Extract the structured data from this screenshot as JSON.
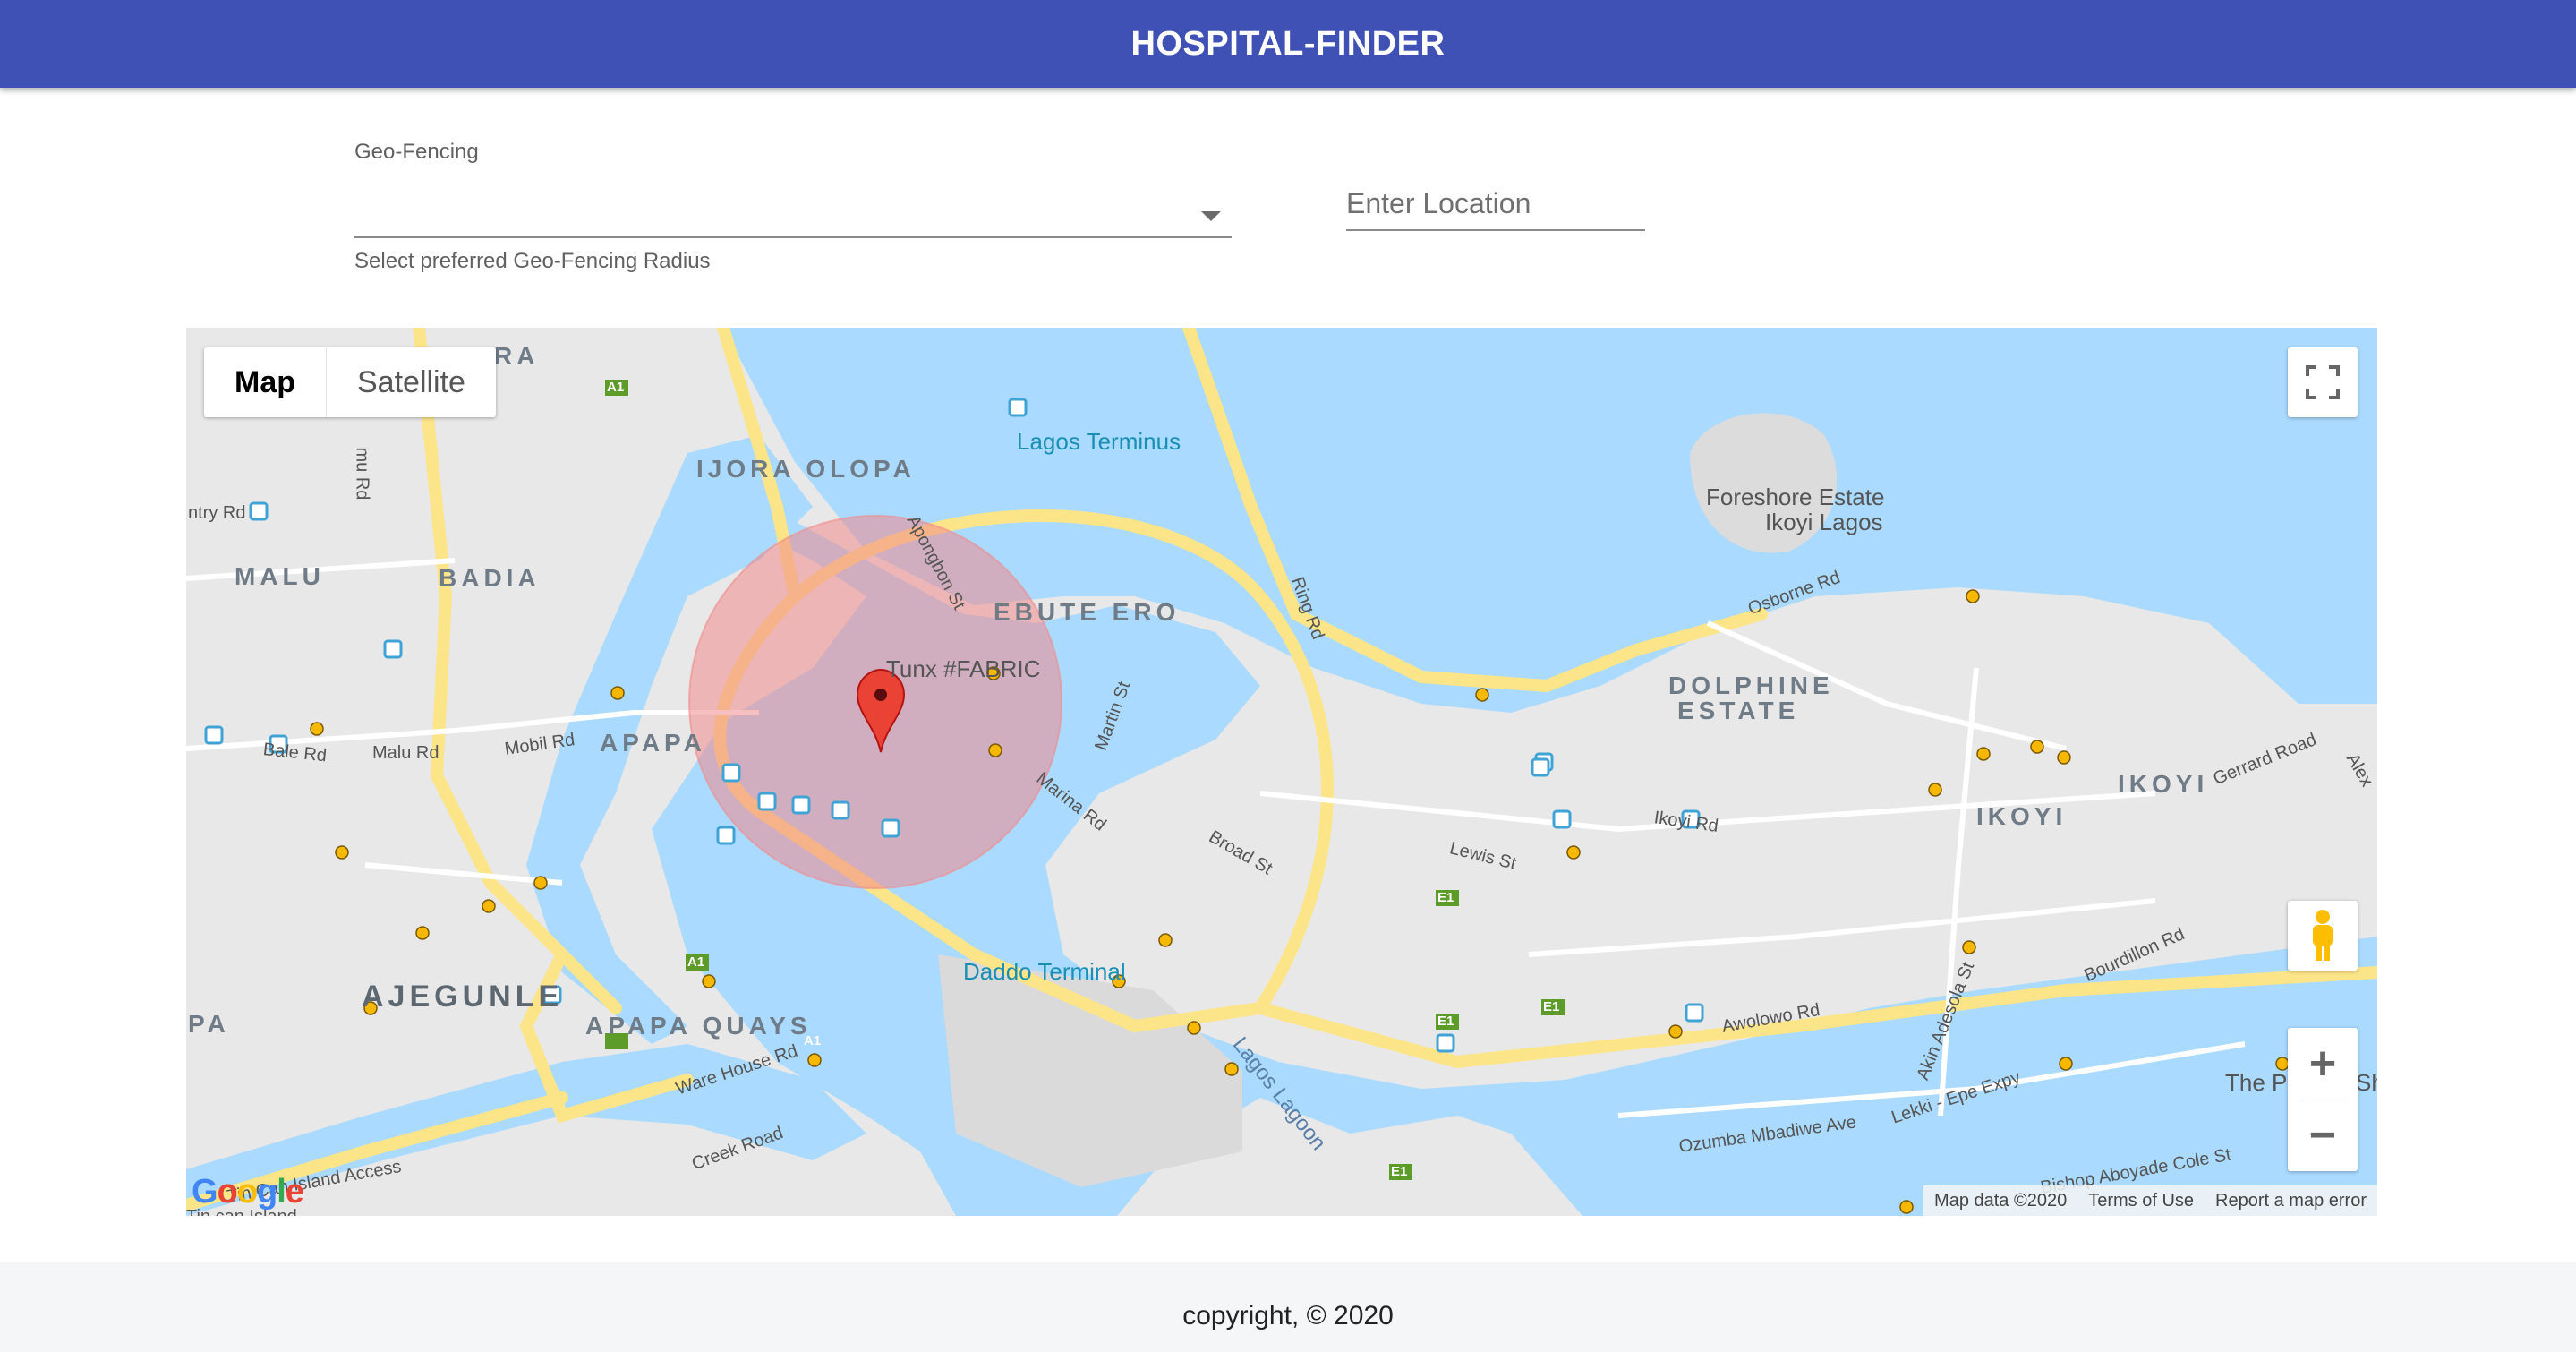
{
  "app": {
    "title": "HOSPITAL-FINDER"
  },
  "form": {
    "geo_label": "Geo-Fencing",
    "geo_helper": "Select preferred Geo-Fencing Radius",
    "location_placeholder": "Enter Location"
  },
  "map": {
    "type_buttons": [
      "Map",
      "Satellite"
    ],
    "selected_type": "Map",
    "logo": "Google",
    "attribution": [
      "Map data ©2020",
      "Terms of Use",
      "Report a map error"
    ],
    "zoom_in": "+",
    "zoom_out": "−",
    "areas": [
      "IJORA OLOPA",
      "MALU",
      "BADIA",
      "APAPA",
      "EBUTE ERO",
      "DOLPHINE",
      "ESTATE",
      "IKOYI",
      "IKOYI",
      "AJEGUNLE",
      "APAPA QUAYS",
      "PA",
      "RA"
    ],
    "streets": [
      "Apongbon St",
      "Ring Rd",
      "Martin St",
      "Marina Rd",
      "Broad St",
      "Lewis St",
      "Ikoyi Rd",
      "Osborne Rd",
      "Gerrard Road",
      "Bourdillon Rd",
      "Akin Adesola St",
      "Awolowo Rd",
      "Ozumba Mbadiwe Ave",
      "Lekki - Epe Expy",
      "Bishop Aboyade Cole St",
      "Mobil Rd",
      "Bale Rd",
      "Malu Rd",
      "Ware House Rd",
      "Creek Road",
      "Tin Can Island Access",
      "ntry Rd",
      "mu Rd",
      "Alex",
      "Tin can Island"
    ],
    "pois": [
      "Lagos Terminus",
      "Tunx #FABRIC",
      "Daddo Terminal",
      "Foreshore Estate",
      "Ikoyi Lagos",
      "The P",
      "Sh"
    ],
    "water_labels": [
      "Lagos Lagoon"
    ],
    "route_badges": [
      "A1",
      "A1",
      "A1",
      "E1",
      "E1",
      "E1",
      "E1"
    ],
    "colors": {
      "appbar": "#3f51b5",
      "circle_fill": "#f08a8a",
      "marker": "#ea4335",
      "water": "#aadaff"
    }
  },
  "footer": {
    "copyright": "copyright, © 2020"
  }
}
